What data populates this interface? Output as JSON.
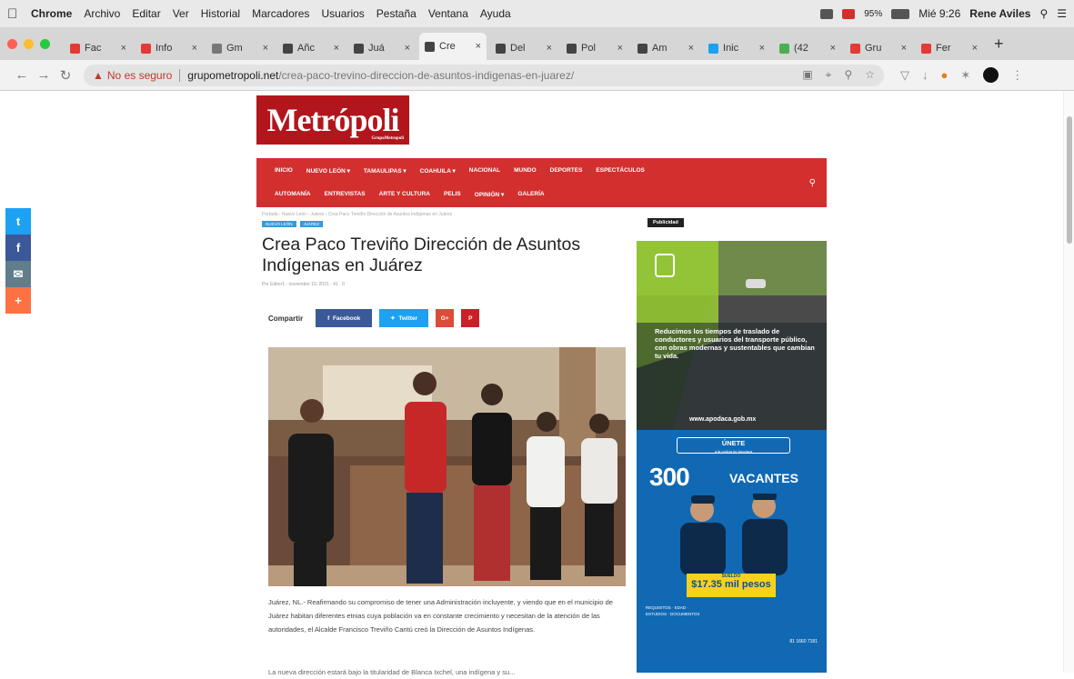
{
  "menubar": {
    "app": "Chrome",
    "items": [
      "Archivo",
      "Editar",
      "Ver",
      "Historial",
      "Marcadores",
      "Usuarios",
      "Pestaña",
      "Ventana",
      "Ayuda"
    ],
    "battery": "95%",
    "clock": "Mié 9:26",
    "user": "Rene Aviles"
  },
  "tabs": [
    {
      "label": "Fac",
      "color": "#e53935"
    },
    {
      "label": "Info",
      "color": "#e53935"
    },
    {
      "label": "Gm",
      "color": "#777777"
    },
    {
      "label": "Añc",
      "color": "#444444"
    },
    {
      "label": "Juá",
      "color": "#444444"
    },
    {
      "label": "Cre",
      "color": "#444444",
      "active": true
    },
    {
      "label": "Del",
      "color": "#444444"
    },
    {
      "label": "Pol",
      "color": "#444444"
    },
    {
      "label": "Am",
      "color": "#444444"
    },
    {
      "label": "Inic",
      "color": "#1da1f2"
    },
    {
      "label": "(42",
      "color": "#4caf50"
    },
    {
      "label": "Gru",
      "color": "#e53935"
    },
    {
      "label": "Fer",
      "color": "#e53935"
    }
  ],
  "address": {
    "insecure_label": "No es seguro",
    "host": "grupometropoli.net",
    "path": "/crea-paco-trevino-direccion-de-asuntos-indigenas-en-juarez/"
  },
  "site": {
    "logo": "Metrópoli",
    "logo_sub": "GrupoMetropoli",
    "nav_row1": [
      "INICIO",
      "NUEVO LEÓN ▾",
      "TAMAULIPAS ▾",
      "COAHUILA ▾",
      "NACIONAL",
      "MUNDO",
      "DEPORTES",
      "ESPECTÁCULOS"
    ],
    "nav_row2": [
      "AUTOMANÍA",
      "ENTREVISTAS",
      "ARTE Y CULTURA",
      "PELIS",
      "OPINIÓN ▾",
      "GALERÍA"
    ]
  },
  "article": {
    "breadcrumbs": "Portada › Nuevo León › Juárez › Crea Paco Treviño Dirección de Asuntos Indígenas en Juárez",
    "categories": [
      "NUEVO LEÓN",
      "JUÁREZ"
    ],
    "title": "Crea Paco Treviño Dirección de Asuntos Indígenas en Juárez",
    "meta": "Por Editor1 · noviembre 10, 2021 · 41 · 0",
    "share_label": "Compartir",
    "share_buttons": [
      {
        "label": "Facebook",
        "color": "#3b5998"
      },
      {
        "label": "Twitter",
        "color": "#1da1f2"
      },
      {
        "label": "G+",
        "color": "#dd4b39"
      },
      {
        "label": "P",
        "color": "#cb2027"
      }
    ],
    "body": "Juárez, NL.- Reafirmando su compromiso de tener una Administración incluyente, y viendo que en el municipio de Juárez habitan diferentes etnias cuya población va en constante crecimiento y necesitan de la atención de las autoridades, el Alcalde Francisco Treviño Cantú creó la Dirección de Asuntos Indígenas.",
    "body_more": "La nueva dirección estará bajo la titularidad de Blanca Ixchel, una indígena y su..."
  },
  "sidebar": {
    "publicidad": "Publicidad",
    "ad1_text": "Reducimos los tiempos de traslado de conductores y usuarios del transporte público, con obras modernas y sustentables que cambian tu vida.",
    "ad1_url": "www.apodaca.gob.mx",
    "ad2_unete": "ÚNETE",
    "ad2_unete_sub": "a la policía de Apodaca",
    "ad2_big": "300",
    "ad2_vac": "VACANTES",
    "ad2_sueldo_label": "SUELDO",
    "ad2_sueldo": "$17.35 mil pesos",
    "ad2_list": "REQUISITOS · EDAD · ESTUDIOS · DOCUMENTOS",
    "ad2_phone": "81 1660 7181"
  }
}
